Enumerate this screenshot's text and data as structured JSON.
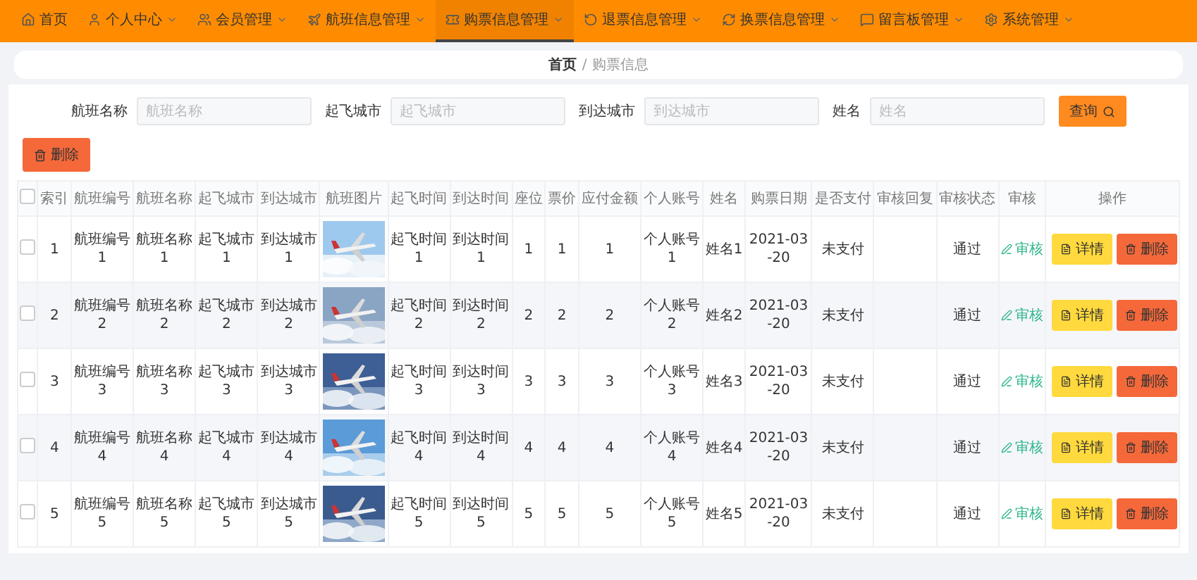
{
  "nav": {
    "items": [
      {
        "label": "首页",
        "selected": false,
        "dropdown": false
      },
      {
        "label": "个人中心",
        "selected": false,
        "dropdown": true
      },
      {
        "label": "会员管理",
        "selected": false,
        "dropdown": true
      },
      {
        "label": "航班信息管理",
        "selected": false,
        "dropdown": true
      },
      {
        "label": "购票信息管理",
        "selected": true,
        "dropdown": true
      },
      {
        "label": "退票信息管理",
        "selected": false,
        "dropdown": true
      },
      {
        "label": "换票信息管理",
        "selected": false,
        "dropdown": true
      },
      {
        "label": "留言板管理",
        "selected": false,
        "dropdown": true
      },
      {
        "label": "系统管理",
        "selected": false,
        "dropdown": true
      }
    ]
  },
  "breadcrumb": [
    "首页",
    "购票信息"
  ],
  "breadcrumb_separator": "/",
  "search": {
    "fields": [
      {
        "label": "航班名称",
        "placeholder": "航班名称"
      },
      {
        "label": "起飞城市",
        "placeholder": "起飞城市"
      },
      {
        "label": "到达城市",
        "placeholder": "到达城市"
      },
      {
        "label": "姓名",
        "placeholder": "姓名"
      }
    ],
    "button": "查询"
  },
  "delete_button": "删除",
  "table": {
    "check_all": {
      "checked": false
    },
    "columns": [
      "索引",
      "航班编号",
      "航班名称",
      "起飞城市",
      "到达城市",
      "航班图片",
      "起飞时间",
      "到达时间",
      "座位",
      "票价",
      "应付金额",
      "个人账号",
      "姓名",
      "购票日期",
      "是否支付",
      "审核回复",
      "审核状态",
      "审核",
      "操作"
    ],
    "rows": [
      {
        "checked": false,
        "cells": [
          "1",
          "航班编号1",
          "航班名称1",
          "起飞城市1",
          "到达城市1",
          {
            "kind": "picture"
          },
          "起飞时间1",
          "到达时间1",
          "1",
          "1",
          "1",
          "个人账号1",
          "姓名1",
          "2021-03-20",
          "未支付",
          null,
          "通过",
          {
            "kind": "link",
            "text": "审核"
          },
          {
            "kind": "actions",
            "buttons": [
              "详情",
              "删除"
            ]
          }
        ]
      },
      {
        "checked": false,
        "cells": [
          "2",
          "航班编号2",
          "航班名称2",
          "起飞城市2",
          "到达城市2",
          {
            "kind": "picture"
          },
          "起飞时间2",
          "到达时间2",
          "2",
          "2",
          "2",
          "个人账号2",
          "姓名2",
          "2021-03-20",
          "未支付",
          null,
          "通过",
          {
            "kind": "link",
            "text": "审核"
          },
          {
            "kind": "actions",
            "buttons": [
              "详情",
              "删除"
            ]
          }
        ]
      },
      {
        "checked": false,
        "cells": [
          "3",
          "航班编号3",
          "航班名称3",
          "起飞城市3",
          "到达城市3",
          {
            "kind": "picture"
          },
          "起飞时间3",
          "到达时间3",
          "3",
          "3",
          "3",
          "个人账号3",
          "姓名3",
          "2021-03-20",
          "未支付",
          null,
          "通过",
          {
            "kind": "link",
            "text": "审核"
          },
          {
            "kind": "actions",
            "buttons": [
              "详情",
              "删除"
            ]
          }
        ]
      },
      {
        "checked": false,
        "cells": [
          "4",
          "航班编号4",
          "航班名称4",
          "起飞城市4",
          "到达城市4",
          {
            "kind": "picture"
          },
          "起飞时间4",
          "到达时间4",
          "4",
          "4",
          "4",
          "个人账号4",
          "姓名4",
          "2021-03-20",
          "未支付",
          null,
          "通过",
          {
            "kind": "link",
            "text": "审核"
          },
          {
            "kind": "actions",
            "buttons": [
              "详情",
              "删除"
            ]
          }
        ]
      },
      {
        "checked": false,
        "cells": [
          "5",
          "航班编号5",
          "航班名称5",
          "起飞城市5",
          "到达城市5",
          {
            "kind": "picture"
          },
          "起飞时间5",
          "到达时间5",
          "5",
          "5",
          "5",
          "个人账号5",
          "姓名5",
          "2021-03-20",
          "未支付",
          null,
          "通过",
          {
            "kind": "link",
            "text": "审核"
          },
          {
            "kind": "actions",
            "buttons": [
              "详情",
              "删除"
            ]
          }
        ]
      }
    ]
  }
}
